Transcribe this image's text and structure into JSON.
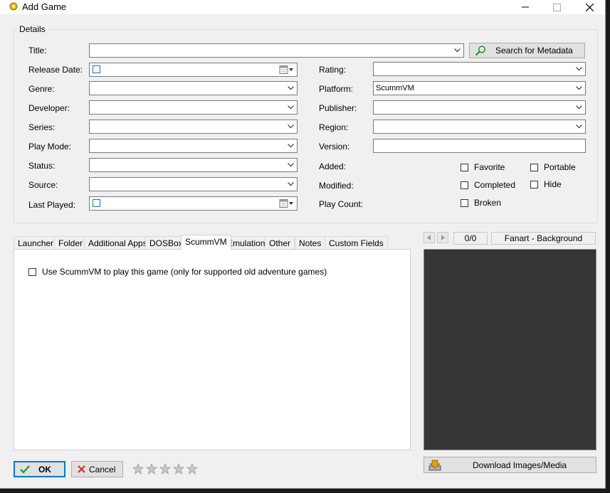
{
  "window": {
    "title": "Add Game",
    "controls": {
      "minimize": "minimize-icon",
      "maximize": "maximize-icon",
      "close": "close-icon"
    }
  },
  "details": {
    "legend": "Details",
    "title_label": "Title:",
    "title_value": "",
    "search_button_label": "Search for Metadata",
    "left_fields": [
      {
        "label": "Release Date:",
        "value": ""
      },
      {
        "label": "Genre:",
        "value": ""
      },
      {
        "label": "Developer:",
        "value": ""
      },
      {
        "label": "Series:",
        "value": ""
      },
      {
        "label": "Play Mode:",
        "value": ""
      },
      {
        "label": "Status:",
        "value": ""
      },
      {
        "label": "Source:",
        "value": ""
      },
      {
        "label": "Last Played:",
        "value": ""
      }
    ],
    "right_fields": [
      {
        "label": "Rating:",
        "value": ""
      },
      {
        "label": "Platform:",
        "value": "ScummVM"
      },
      {
        "label": "Publisher:",
        "value": ""
      },
      {
        "label": "Region:",
        "value": ""
      },
      {
        "label": "Version:",
        "value": ""
      },
      {
        "label": "Added:",
        "value": ""
      },
      {
        "label": "Modified:",
        "value": ""
      },
      {
        "label": "Play Count:",
        "value": ""
      }
    ],
    "checkboxes": [
      {
        "label": "Favorite",
        "checked": false
      },
      {
        "label": "Portable",
        "checked": false
      },
      {
        "label": "Completed",
        "checked": false
      },
      {
        "label": "Hide",
        "checked": false
      },
      {
        "label": "Broken",
        "checked": false
      }
    ]
  },
  "tabs": [
    "Launcher",
    "Folder",
    "Additional Apps",
    "DOSBox",
    "ScummVM",
    "Emulation",
    "Other",
    "Notes",
    "Custom Fields"
  ],
  "active_tab": "ScummVM",
  "scummvm_tab": {
    "use_scummvm_label": "Use ScummVM to play this game (only for supported old adventure games)",
    "use_scummvm_checked": false
  },
  "media": {
    "count": "0/0",
    "image_type": "Fanart - Background",
    "download_label": "Download Images/Media"
  },
  "footer": {
    "ok_label": "OK",
    "cancel_label": "Cancel",
    "star_rating": 0,
    "star_max": 5
  },
  "colors": {
    "window_bg": "#f0f0f0",
    "image_panel_bg": "#363636",
    "ok_border": "#0078d7",
    "cancel_icon": "#d32f2f",
    "ok_icon": "#2e9e2e"
  }
}
